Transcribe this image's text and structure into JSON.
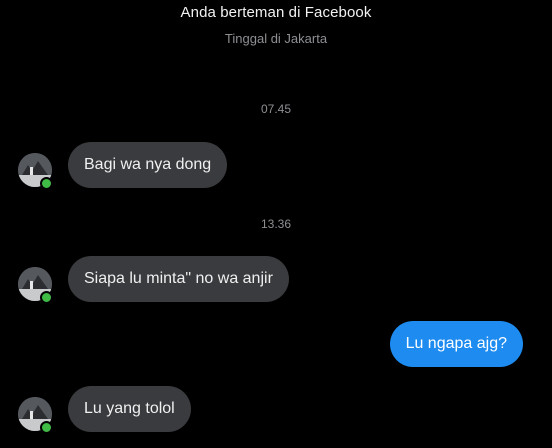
{
  "header": {
    "friend_status": "Anda berteman di Facebook",
    "location": "Tinggal di Jakarta"
  },
  "messages": [
    {
      "type": "timestamp",
      "text": "07.45"
    },
    {
      "type": "incoming",
      "text": "Bagi wa nya dong"
    },
    {
      "type": "timestamp",
      "text": "13.36"
    },
    {
      "type": "incoming",
      "text": "Siapa lu minta\" no wa anjir"
    },
    {
      "type": "outgoing",
      "text": "Lu ngapa ajg?"
    },
    {
      "type": "incoming",
      "text": "Lu yang tolol"
    }
  ],
  "colors": {
    "background": "#000000",
    "incoming_bubble": "#3a3b3e",
    "outgoing_bubble": "#1d8bf0",
    "online_indicator": "#3fbb46",
    "muted_text": "#8d8f93"
  },
  "icons": {
    "avatar": "contact-avatar",
    "presence": "online-dot-icon"
  }
}
